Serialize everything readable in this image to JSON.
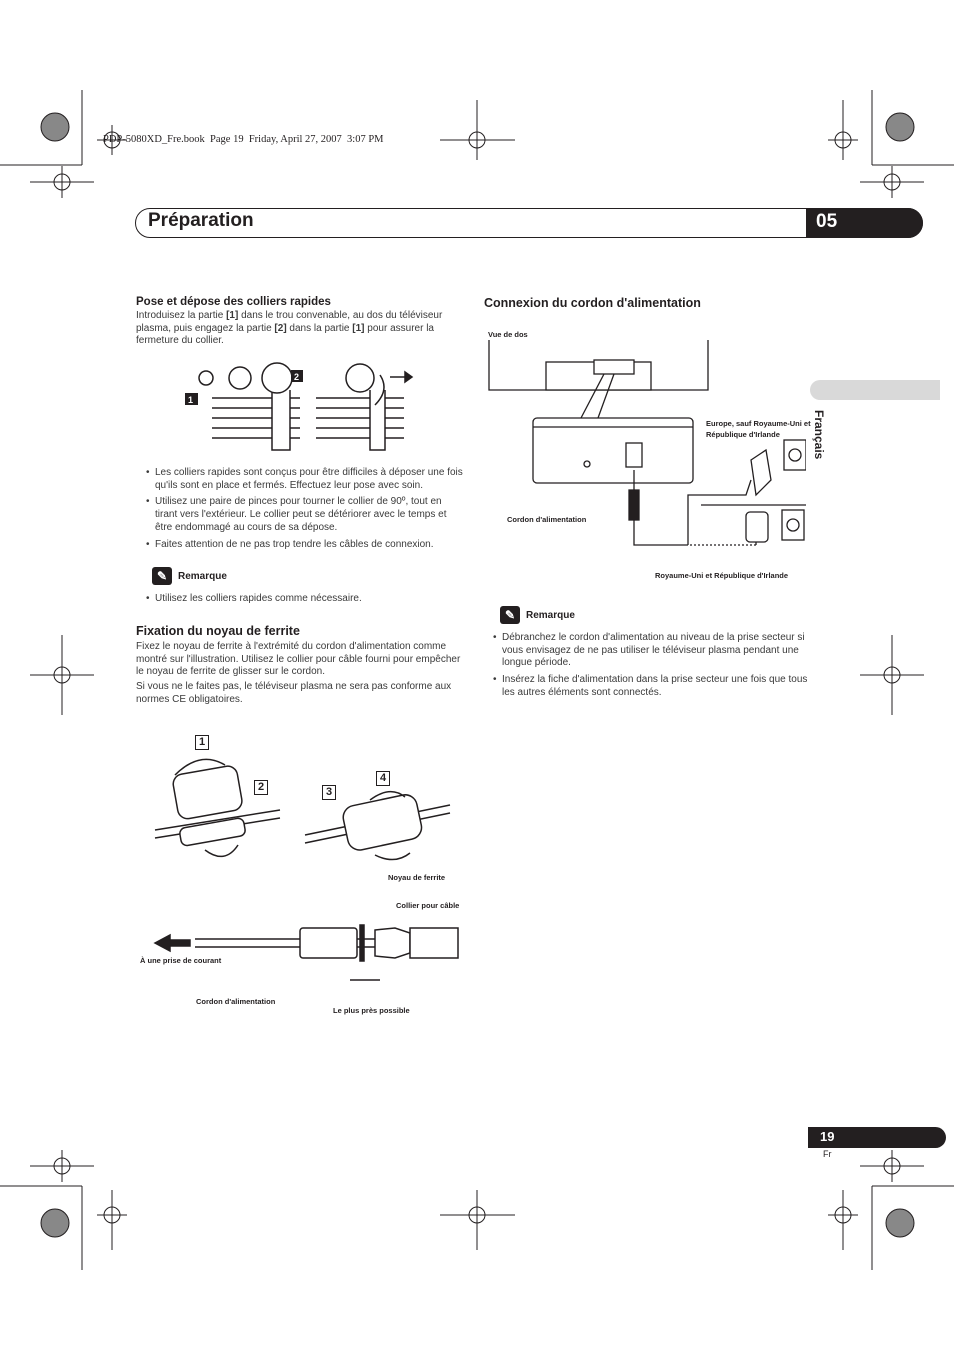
{
  "print_info": "PDP-5080XD_Fre.book  Page 19  Friday, April 27, 2007  3:07 PM",
  "header": {
    "title": "Préparation",
    "chapter": "05"
  },
  "side_tab": "Français",
  "footer": {
    "page": "19",
    "lang": "Fr"
  },
  "left": {
    "s1": {
      "title": "Pose et dépose des colliers rapides",
      "intro": [
        "Introduisez la partie ",
        "[1]",
        " dans le trou convenable, au dos du téléviseur plasma, puis engagez la partie ",
        "[2]",
        " dans la partie ",
        "[1]",
        " pour assurer la fermeture du collier."
      ],
      "fig_labels": [
        "1",
        "2"
      ],
      "bullets": [
        "Les colliers rapides sont conçus pour être difficiles à déposer une fois qu'ils sont en place et fermés. Effectuez leur pose avec soin.",
        "Utilisez une paire de pinces pour tourner le collier de 90º, tout en tirant vers l'extérieur. Le collier peut se détériorer avec le temps et être endommagé au cours de sa dépose.",
        "Faites attention de ne pas trop tendre les câbles de connexion."
      ],
      "note_title": "Remarque",
      "note_bullets": [
        "Utilisez les colliers rapides comme nécessaire."
      ]
    },
    "s2": {
      "title": "Fixation du noyau de ferrite",
      "paras": [
        "Fixez le noyau de ferrite à l'extrémité du cordon d'alimentation comme montré sur l'illustration. Utilisez le collier pour câble fourni pour empêcher le noyau de ferrite de glisser sur le cordon.",
        "Si vous ne le faites pas, le téléviseur plasma ne sera pas conforme aux normes CE obligatoires."
      ],
      "steps": [
        "1",
        "2",
        "3",
        "4"
      ],
      "labels": {
        "core": "Noyau de ferrite",
        "clamp": "Collier pour câble",
        "outlet": "À une prise de courant",
        "cord": "Cordon d'alimentation",
        "closest": "Le plus près possible"
      }
    }
  },
  "right": {
    "title": "Connexion du cordon d'alimentation",
    "labels": {
      "rear": "Vue de dos",
      "europe": "Europe, sauf Royaume-Uni et République d'Irlande",
      "cord": "Cordon d'alimentation",
      "uk": "Royaume-Uni et République d'Irlande"
    },
    "note_title": "Remarque",
    "note_bullets": [
      "Débranchez le cordon d'alimentation au niveau de la prise secteur si vous envisagez de ne pas utiliser le téléviseur plasma pendant une longue période.",
      "Insérez la fiche d'alimentation dans la prise secteur une fois que tous les autres éléments sont connectés."
    ]
  }
}
